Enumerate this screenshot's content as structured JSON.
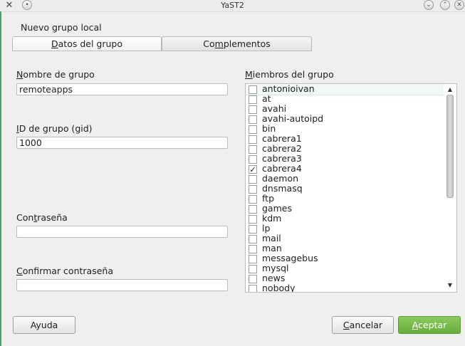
{
  "window": {
    "title": "YaST2",
    "app_icon": "yast-icon"
  },
  "dialog": {
    "heading": "Nuevo grupo local",
    "tabs": [
      {
        "label": "Datos del grupo",
        "accel": "D",
        "rest": "atos del grupo",
        "active": true
      },
      {
        "label": "Complementos",
        "accel": "m",
        "pre": "Co",
        "rest": "plementos",
        "active": false
      }
    ],
    "fields": {
      "group_name": {
        "label_accel": "N",
        "label_rest": "ombre de grupo",
        "value": "remoteapps"
      },
      "gid": {
        "label_accel": "I",
        "label_rest": "D de grupo (gid)",
        "value": "1000"
      },
      "password": {
        "label_pre": "Con",
        "label_accel": "t",
        "label_rest": "raseña",
        "value": ""
      },
      "confirm_password": {
        "label_accel": "C",
        "label_rest": "onfirmar contraseña",
        "value": ""
      }
    },
    "members": {
      "label_accel": "M",
      "label_rest": "iembros del grupo",
      "items": [
        {
          "name": "antonioivan",
          "checked": false
        },
        {
          "name": "at",
          "checked": false
        },
        {
          "name": "avahi",
          "checked": false
        },
        {
          "name": "avahi-autoipd",
          "checked": false
        },
        {
          "name": "bin",
          "checked": false
        },
        {
          "name": "cabrera1",
          "checked": false
        },
        {
          "name": "cabrera2",
          "checked": false
        },
        {
          "name": "cabrera3",
          "checked": false
        },
        {
          "name": "cabrera4",
          "checked": true
        },
        {
          "name": "daemon",
          "checked": false
        },
        {
          "name": "dnsmasq",
          "checked": false
        },
        {
          "name": "ftp",
          "checked": false
        },
        {
          "name": "games",
          "checked": false
        },
        {
          "name": "kdm",
          "checked": false
        },
        {
          "name": "lp",
          "checked": false
        },
        {
          "name": "mail",
          "checked": false
        },
        {
          "name": "man",
          "checked": false
        },
        {
          "name": "messagebus",
          "checked": false
        },
        {
          "name": "mysql",
          "checked": false
        },
        {
          "name": "news",
          "checked": false
        },
        {
          "name": "nobody",
          "checked": false
        }
      ],
      "scroll_position": 0,
      "visible_fraction": 0.55
    },
    "buttons": {
      "help": "Ayuda",
      "cancel": {
        "accel": "C",
        "rest": "ancelar"
      },
      "accept": {
        "accel": "A",
        "rest": "ceptar"
      }
    }
  }
}
